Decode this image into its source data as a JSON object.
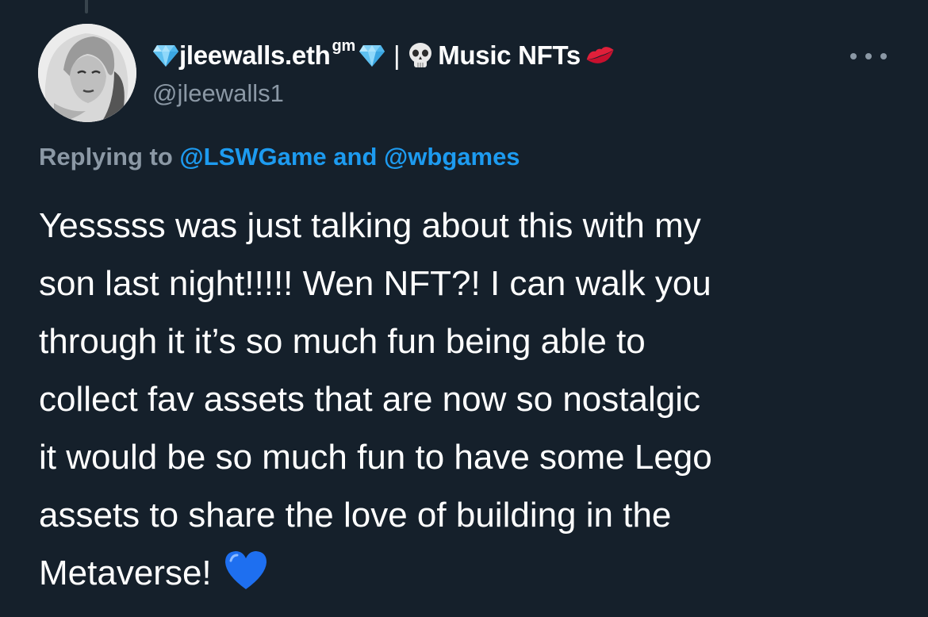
{
  "author": {
    "display_name_prefix": "jleewalls.eth",
    "display_name_superscript": "gm",
    "display_name_separator": "|",
    "display_name_suffix": "Music NFTs",
    "handle": "@jleewalls1",
    "icons": [
      "diamond-icon",
      "diamond-icon",
      "skull-icon",
      "kiss-lips-icon"
    ]
  },
  "reply": {
    "prefix": "Replying to",
    "mention_1": "@LSWGame",
    "conjunction": "and",
    "mention_2": "@wbgames"
  },
  "tweet": {
    "text": "Yesssss was just talking about this with my\nson last night!!!!! Wen NFT?! I can walk you\nthrough it it’s so much fun being able to\ncollect fav assets that are now so nostalgic\nit would be so much fun to have some Lego\nassets to share the love of building in the\nMetaverse!",
    "emoji": "blue-heart-icon"
  },
  "colors": {
    "background": "#15202b",
    "primary_text": "#ffffff",
    "secondary_text": "#8b98a5",
    "link": "#1d9bf0"
  }
}
